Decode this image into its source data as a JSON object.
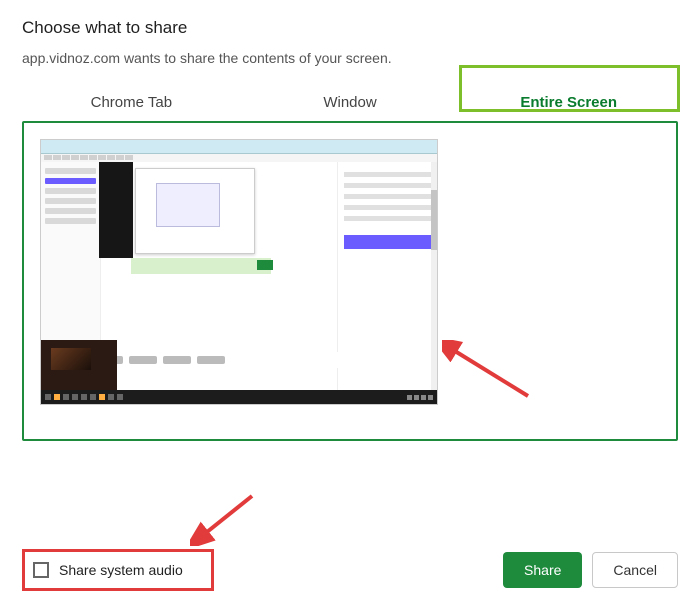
{
  "dialog": {
    "title": "Choose what to share",
    "subtitle": "app.vidnoz.com wants to share the contents of your screen."
  },
  "tabs": {
    "chrome_tab": "Chrome Tab",
    "window": "Window",
    "entire_screen": "Entire Screen",
    "active": "entire_screen"
  },
  "audio": {
    "label": "Share system audio",
    "checked": false
  },
  "buttons": {
    "share": "Share",
    "cancel": "Cancel"
  },
  "annotations": {
    "highlight_tab": "entire_screen",
    "highlight_audio": true,
    "arrows": [
      "to-preview",
      "to-audio"
    ]
  }
}
